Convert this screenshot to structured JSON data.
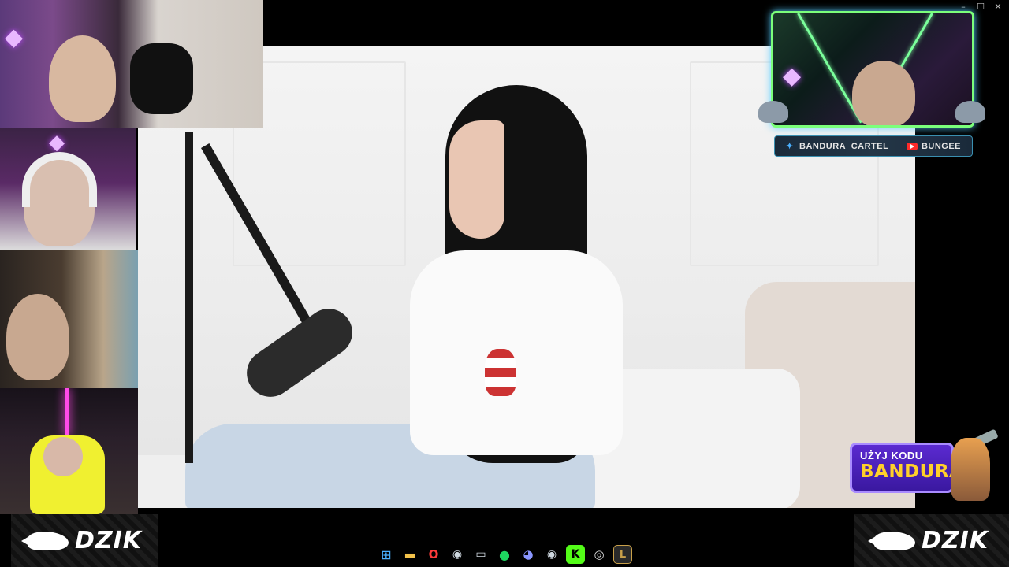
{
  "window_controls": {
    "minimize": "–",
    "maximize": "☐",
    "close": "✕"
  },
  "social_bar": {
    "twitter_handle": "BANDURA_CARTEL",
    "youtube_handle": "BUNGEE"
  },
  "promo": {
    "line1": "UŻYJ KODU",
    "code": "BANDURA"
  },
  "brand": {
    "left": "DZIK",
    "right": "DZIK"
  },
  "taskbar": {
    "icons": [
      {
        "name": "windows-start-icon",
        "glyph": "⊞"
      },
      {
        "name": "file-explorer-icon",
        "glyph": "▬"
      },
      {
        "name": "opera-icon",
        "glyph": "O"
      },
      {
        "name": "steam-icon",
        "glyph": "◉"
      },
      {
        "name": "monitor-icon",
        "glyph": "▭"
      },
      {
        "name": "spotify-icon",
        "glyph": "●"
      },
      {
        "name": "discord-icon",
        "glyph": "◕"
      },
      {
        "name": "steam-icon-2",
        "glyph": "◉"
      },
      {
        "name": "kick-icon",
        "glyph": "K"
      },
      {
        "name": "chrome-icon",
        "glyph": "◎"
      },
      {
        "name": "league-of-legends-icon",
        "glyph": "L"
      }
    ]
  },
  "colors": {
    "promo_bg": "#4a20c0",
    "promo_code": "#ffd02a",
    "neon_purple": "#c04bff",
    "frame_green": "#7bff7b"
  }
}
